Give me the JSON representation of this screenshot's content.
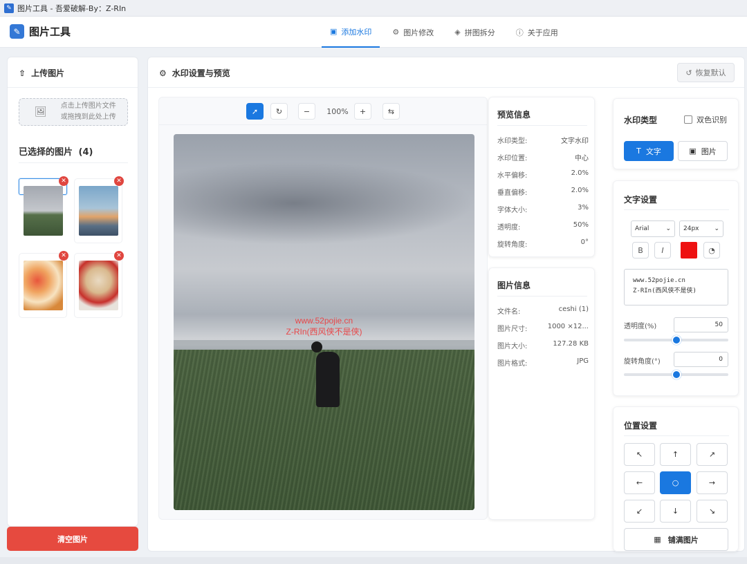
{
  "window": {
    "title": "图片工具 - 吾爱破解-By：Z-RIn"
  },
  "header": {
    "app_name": "图片工具",
    "tabs": [
      {
        "label": "添加水印",
        "icon": "image-icon",
        "active": true
      },
      {
        "label": "图片修改",
        "icon": "gear-icon",
        "active": false
      },
      {
        "label": "拼图拆分",
        "icon": "layers-icon",
        "active": false
      },
      {
        "label": "关于应用",
        "icon": "info-icon",
        "active": false
      }
    ]
  },
  "left_panel": {
    "title": "上传图片",
    "dropzone_line1": "点击上传图片文件",
    "dropzone_line2": "或拖拽到此处上传",
    "selected_title": "已选择的图片",
    "selected_count": "(4)",
    "thumbnails": [
      {
        "name": "grass-field",
        "selected": true
      },
      {
        "name": "tree-sunset",
        "selected": false
      },
      {
        "name": "cake",
        "selected": false
      },
      {
        "name": "cat",
        "selected": false
      }
    ],
    "clear_button": "清空图片"
  },
  "main_panel": {
    "title": "水印设置与预览",
    "reset_button": "恢复默认",
    "toolbar": {
      "zoom": "100%"
    },
    "watermark_line1": "www.52pojie.cn",
    "watermark_line2": "Z-RIn(西风侠不是侠)"
  },
  "preview_info": {
    "title": "预览信息",
    "rows": [
      {
        "k": "水印类型:",
        "v": "文字水印"
      },
      {
        "k": "水印位置:",
        "v": "中心"
      },
      {
        "k": "水平偏移:",
        "v": "2.0%"
      },
      {
        "k": "垂直偏移:",
        "v": "2.0%"
      },
      {
        "k": "字体大小:",
        "v": "3%"
      },
      {
        "k": "透明度:",
        "v": "50%"
      },
      {
        "k": "旋转角度:",
        "v": "0°"
      }
    ]
  },
  "image_info": {
    "title": "图片信息",
    "rows": [
      {
        "k": "文件名:",
        "v": "ceshi (1)"
      },
      {
        "k": "图片尺寸:",
        "v": "1000 ×12..."
      },
      {
        "k": "图片大小:",
        "v": "127.28 KB"
      },
      {
        "k": "图片格式:",
        "v": "JPG"
      }
    ]
  },
  "watermark_type": {
    "title": "水印类型",
    "dual_color_label": "双色识别",
    "text_button": "文字",
    "image_button": "图片"
  },
  "text_settings": {
    "title": "文字设置",
    "font": "Arial",
    "size": "24px",
    "bold_label": "B",
    "italic_label": "I",
    "color": "#ee1111",
    "text_line1": "www.52pojie.cn",
    "text_line2": "Z-RIn(西风侠不是侠)",
    "opacity_label": "透明度(%)",
    "opacity_value": "50",
    "opacity_fraction": 0.5,
    "rotation_label": "旋转角度(°)",
    "rotation_value": "0",
    "rotation_fraction": 0.5
  },
  "position_settings": {
    "title": "位置设置",
    "tile_button": "铺满图片"
  },
  "colors": {
    "accent": "#1a78e0",
    "danger": "#e64a3f"
  }
}
